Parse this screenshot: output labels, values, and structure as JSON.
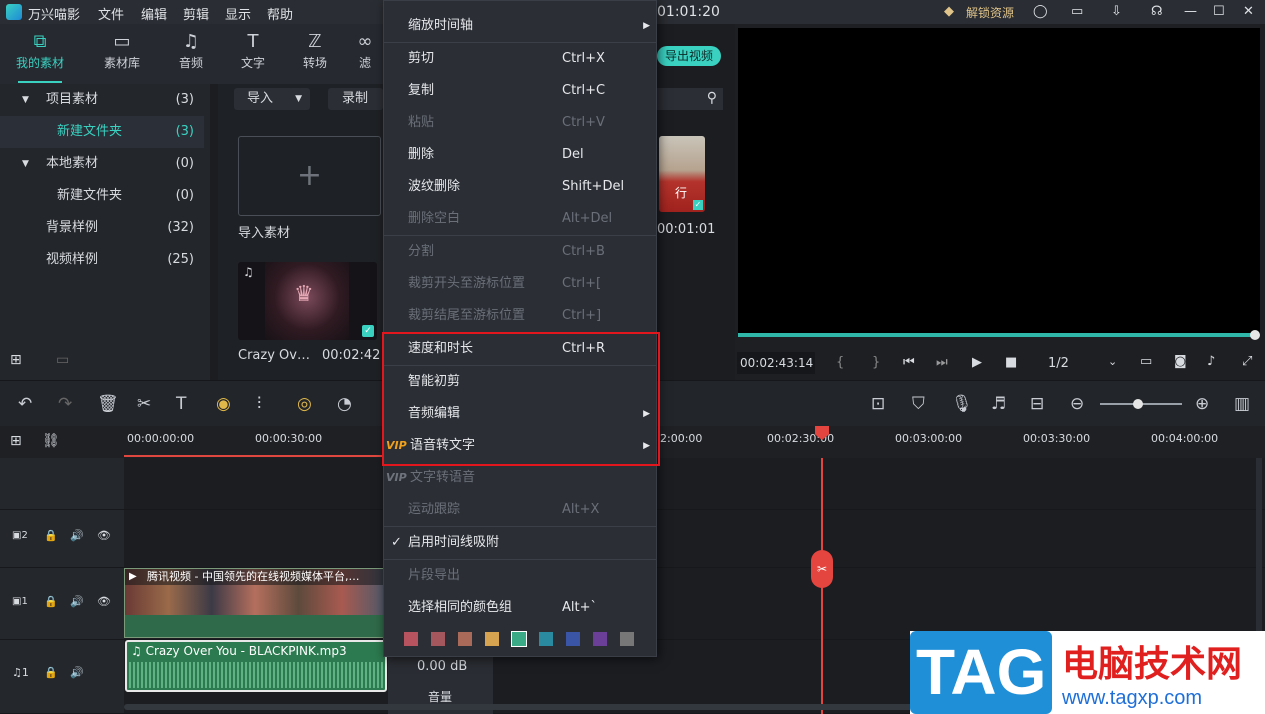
{
  "app": {
    "title": "万兴喵影",
    "time": "01:01:20",
    "unlock": "解锁资源"
  },
  "menus": [
    "文件",
    "编辑",
    "剪辑",
    "显示",
    "帮助"
  ],
  "toolbar": [
    {
      "label": "我的素材",
      "icon": "folder-stack-icon"
    },
    {
      "label": "素材库",
      "icon": "folder-icon"
    },
    {
      "label": "音频",
      "icon": "music-note-icon"
    },
    {
      "label": "文字",
      "icon": "text-icon"
    },
    {
      "label": "转场",
      "icon": "transition-icon"
    },
    {
      "label": "滤",
      "icon": "filter-icon"
    }
  ],
  "library": [
    {
      "label": "项目素材",
      "count": "(3)"
    },
    {
      "label": "新建文件夹",
      "count": "(3)"
    },
    {
      "label": "本地素材",
      "count": "(0)"
    },
    {
      "label": "新建文件夹",
      "count": "(0)"
    },
    {
      "label": "背景样例",
      "count": "(32)"
    },
    {
      "label": "视频样例",
      "count": "(25)"
    }
  ],
  "media": {
    "import_btn": "导入",
    "record_btn": "录制",
    "import_tile": "导入素材",
    "clip_name": "Crazy Ov…",
    "clip_duration": "00:02:42",
    "side_duration": "00:01:01",
    "export_btn": "导出视频",
    "side_char": "行"
  },
  "preview": {
    "timecode": "00:02:43:14",
    "ratio": "1/2",
    "brace_open": "{",
    "brace_close": "}"
  },
  "ruler": [
    "00:00:00:00",
    "00:00:30:00",
    "2:00:00",
    "00:02:30:00",
    "00:03:00:00",
    "00:03:30:00",
    "00:04:00:00"
  ],
  "tracks": {
    "v2": "2",
    "v1": "1",
    "a1": "1",
    "video_clip": "腾讯视频 - 中国领先的在线视频媒体平台,…",
    "audio_clip": "Crazy Over You - BLACKPINK.mp3",
    "volume": "0.00 dB",
    "volume_label": "音量"
  },
  "context_menu": [
    {
      "label": "缩放时间轴",
      "shortcut": "",
      "arrow": true,
      "disabled": false
    },
    {
      "label": "剪切",
      "shortcut": "Ctrl+X",
      "disabled": false
    },
    {
      "label": "复制",
      "shortcut": "Ctrl+C",
      "disabled": false
    },
    {
      "label": "粘贴",
      "shortcut": "Ctrl+V",
      "disabled": true
    },
    {
      "label": "删除",
      "shortcut": "Del",
      "disabled": false
    },
    {
      "label": "波纹删除",
      "shortcut": "Shift+Del",
      "disabled": false
    },
    {
      "label": "删除空白",
      "shortcut": "Alt+Del",
      "disabled": true
    },
    {
      "label": "分割",
      "shortcut": "Ctrl+B",
      "disabled": true
    },
    {
      "label": "裁剪开头至游标位置",
      "shortcut": "Ctrl+[",
      "disabled": true
    },
    {
      "label": "裁剪结尾至游标位置",
      "shortcut": "Ctrl+]",
      "disabled": true
    },
    {
      "label": "速度和时长",
      "shortcut": "Ctrl+R",
      "disabled": false
    },
    {
      "label": "智能初剪",
      "shortcut": "",
      "disabled": false
    },
    {
      "label": "音频编辑",
      "shortcut": "",
      "arrow": true,
      "disabled": false
    },
    {
      "label": "语音转文字",
      "shortcut": "",
      "arrow": true,
      "vip": true,
      "disabled": false
    },
    {
      "label": "文字转语音",
      "shortcut": "",
      "vip": true,
      "disabled": true
    },
    {
      "label": "运动跟踪",
      "shortcut": "Alt+X",
      "disabled": true
    },
    {
      "label": "启用时间线吸附",
      "shortcut": "",
      "check": true,
      "disabled": false
    },
    {
      "label": "片段导出",
      "shortcut": "",
      "disabled": true
    },
    {
      "label": "选择相同的颜色组",
      "shortcut": "Alt+`",
      "disabled": false
    }
  ],
  "vip_badge": "VIP",
  "check_mark": "✓",
  "color_swatches": [
    "#b7525f",
    "#a4575d",
    "#a96a5a",
    "#d6a451",
    "#3aa985",
    "#2a8aa0",
    "#3a55a6",
    "#6b3e98",
    "#777777"
  ],
  "watermark": {
    "tag": "TAG",
    "site_cn": "电脑技术网",
    "url": "www.tagxp.com"
  }
}
